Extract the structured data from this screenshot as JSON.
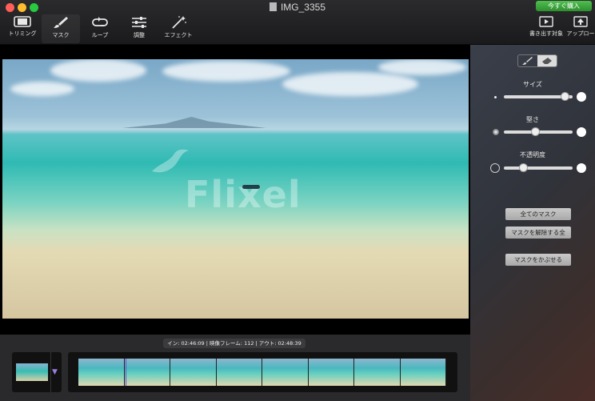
{
  "window": {
    "title": "IMG_3355",
    "buy_button": "今すぐ購入"
  },
  "toolbar": {
    "tools": [
      {
        "label": "トリミング",
        "icon": "trim-icon"
      },
      {
        "label": "マスク",
        "icon": "brush-icon"
      },
      {
        "label": "ループ",
        "icon": "loop-icon"
      },
      {
        "label": "調整",
        "icon": "sliders-icon"
      },
      {
        "label": "エフェクト",
        "icon": "magic-wand-icon"
      }
    ],
    "right_tools": [
      {
        "label": "書き出す対象",
        "icon": "export-icon"
      },
      {
        "label": "アップロー",
        "icon": "upload-icon"
      }
    ]
  },
  "preview": {
    "watermark": "Flixel"
  },
  "mask_panel": {
    "size_label": "サイズ",
    "size_value": 0.95,
    "hardness_label": "堅さ",
    "hardness_value": 0.45,
    "opacity_label": "不透明度",
    "opacity_value": 0.25,
    "buttons": {
      "all_masks": "全てのマスク",
      "unmask_all": "マスクを解除する全",
      "apply_mask": "マスクをかぶせる"
    }
  },
  "timeline": {
    "readout": "イン: 02:46:09 | 映像フレーム: 112 | アウト: 02:48:39",
    "frame_count": 8
  },
  "colors": {
    "buy_green": "#3aa83a",
    "playhead": "#6b4bd6"
  }
}
